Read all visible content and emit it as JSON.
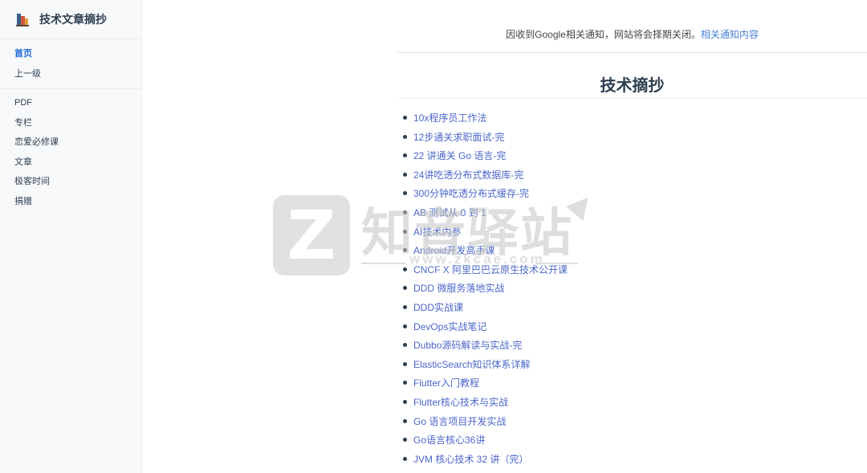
{
  "sidebar": {
    "brand_title": "技术文章摘抄",
    "primary_items": [
      {
        "label": "首页"
      },
      {
        "label": "上一级"
      }
    ],
    "secondary_items": [
      {
        "label": "PDF"
      },
      {
        "label": "专栏"
      },
      {
        "label": "恋爱必修课"
      },
      {
        "label": "文章"
      },
      {
        "label": "极客时间"
      },
      {
        "label": "捐赠"
      }
    ]
  },
  "notice": {
    "text": "因收到Google相关通知，网站将会择期关闭。",
    "link_label": "相关通知内容"
  },
  "page_title": "技术摘抄",
  "articles": [
    "10x程序员工作法",
    "12步通关求职面试-完",
    "22 讲通关 Go 语言-完",
    "24讲吃透分布式数据库-完",
    "300分钟吃透分布式缓存-完",
    "AB 测试从 0 到 1",
    "AI技术内参",
    "Android开发高手课",
    "CNCF X 阿里巴巴云原生技术公开课",
    "DDD 微服务落地实战",
    "DDD实战课",
    "DevOps实战笔记",
    "Dubbo源码解读与实战-完",
    "ElasticSearch知识体系详解",
    "Flutter入门教程",
    "Flutter核心技术与实战",
    "Go 语言项目开发实战",
    "Go语言核心36讲",
    "JVM 核心技术 32 讲（完）"
  ],
  "watermark": {
    "logo_letter": "Z",
    "text": "知音驿站",
    "url": "www.zkcae.com"
  },
  "colors": {
    "link": "#4a67c8",
    "active_nav": "#1e6bd6",
    "sidebar_bg": "#f8f9fb"
  }
}
